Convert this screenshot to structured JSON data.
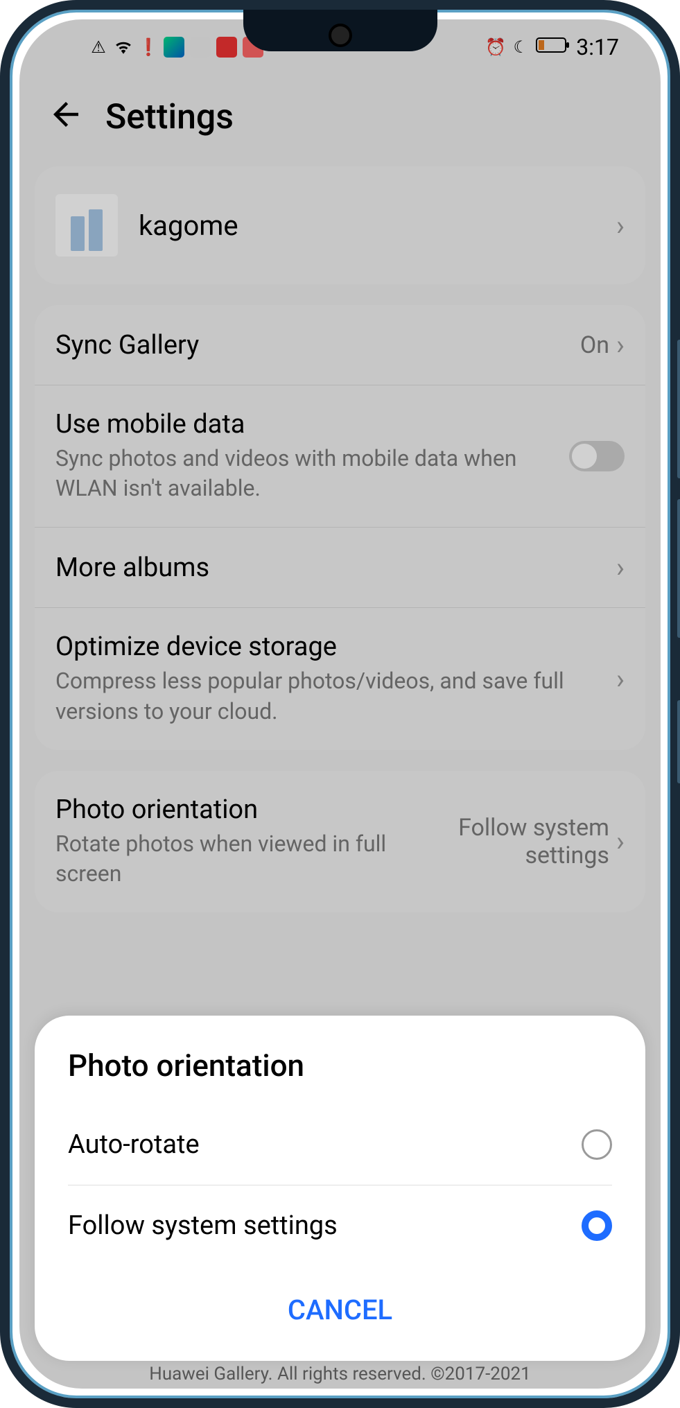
{
  "status": {
    "time": "3:17",
    "icons": [
      "alert",
      "wifi",
      "battery-alert",
      "video-app",
      "cloud",
      "book-app",
      "cat-app",
      "alarm",
      "dnd",
      "battery-low"
    ]
  },
  "header": {
    "title": "Settings"
  },
  "account": {
    "name": "kagome"
  },
  "settings": {
    "sync": {
      "label": "Sync Gallery",
      "value": "On"
    },
    "mobile": {
      "label": "Use mobile data",
      "sub": "Sync photos and videos with mobile data when WLAN isn't available.",
      "enabled": false
    },
    "more_albums": {
      "label": "More albums"
    },
    "optimize": {
      "label": "Optimize device storage",
      "sub": "Compress less popular photos/videos, and save full versions to your cloud."
    },
    "orientation": {
      "label": "Photo orientation",
      "sub": "Rotate photos when viewed in full screen",
      "value": "Follow system settings"
    }
  },
  "dialog": {
    "title": "Photo orientation",
    "options": [
      {
        "label": "Auto-rotate",
        "selected": false
      },
      {
        "label": "Follow system settings",
        "selected": true
      }
    ],
    "cancel": "CANCEL"
  },
  "footer": "Huawei Gallery. All rights reserved. ©2017-2021"
}
